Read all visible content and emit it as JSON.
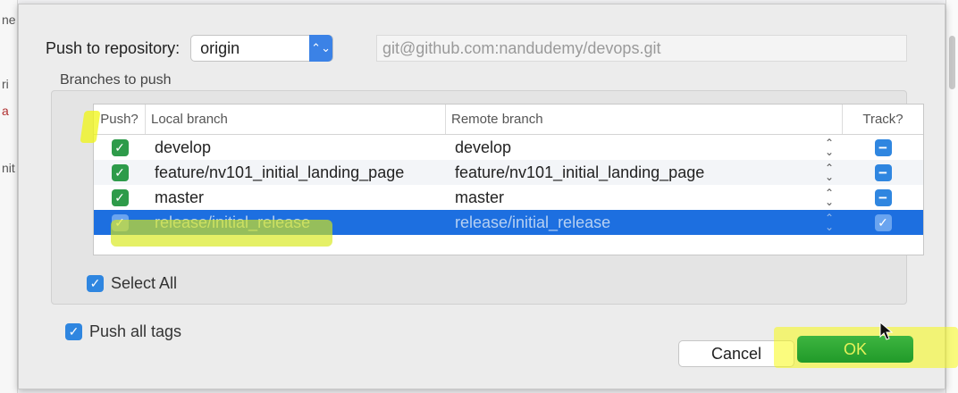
{
  "background": {
    "left_fragments": [
      "ne",
      "ri",
      "a",
      "nit"
    ]
  },
  "dialog": {
    "repo_label": "Push to repository:",
    "repo_selected": "origin",
    "repo_url": "git@github.com:nandudemy/devops.git",
    "branches_label": "Branches to push",
    "table": {
      "headers": {
        "push": "Push?",
        "local": "Local branch",
        "remote": "Remote branch",
        "track": "Track?"
      },
      "rows": [
        {
          "push": true,
          "local": "develop",
          "remote": "develop",
          "track": "minus"
        },
        {
          "push": true,
          "local": "feature/nv101_initial_landing_page",
          "remote": "feature/nv101_initial_landing_page",
          "track": "minus"
        },
        {
          "push": true,
          "local": "master",
          "remote": "master",
          "track": "minus"
        },
        {
          "push": true,
          "local": "release/initial_release",
          "remote": "release/initial_release",
          "track": "checked",
          "selected": true
        }
      ]
    },
    "select_all_label": "Select All",
    "select_all_checked": true,
    "push_tags_label": "Push all tags",
    "push_tags_checked": true,
    "cancel_label": "Cancel",
    "ok_label": "OK"
  },
  "colors": {
    "accent": "#1d6fe0",
    "ok_button": "#2ea334",
    "highlighter": "#f0f514"
  }
}
